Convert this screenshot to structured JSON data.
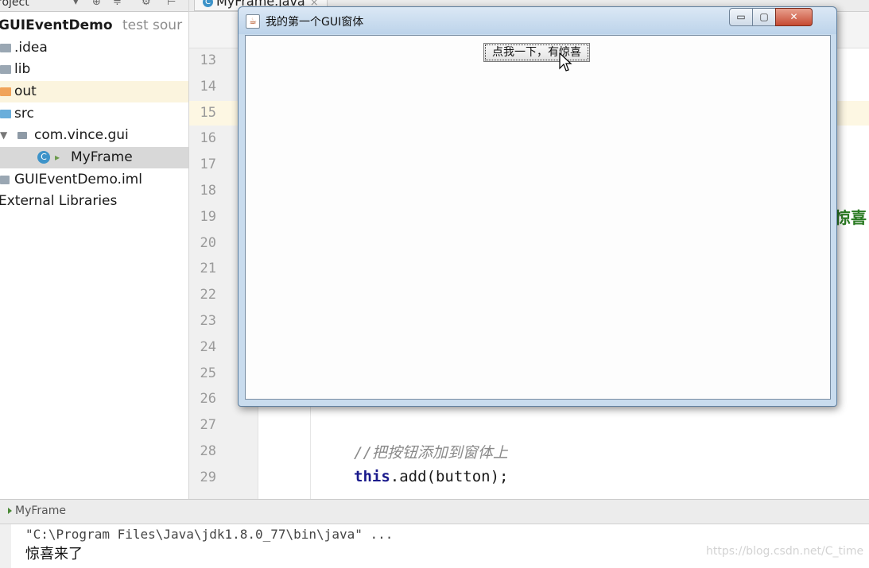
{
  "project": {
    "header_label": "roject",
    "root": {
      "name": "GUIEventDemo",
      "note": "test sour"
    },
    "items": [
      {
        "label": ".idea"
      },
      {
        "label": "lib"
      },
      {
        "label": "out"
      },
      {
        "label": "src"
      },
      {
        "label": "com.vince.gui"
      },
      {
        "label": "MyFrame"
      },
      {
        "label": "GUIEventDemo.iml"
      },
      {
        "label": "External Libraries"
      }
    ]
  },
  "editor": {
    "tab_label": "MyFrame.java",
    "line_numbers": [
      "13",
      "14",
      "15",
      "16",
      "17",
      "18",
      "19",
      "20",
      "21",
      "22",
      "23",
      "24",
      "25",
      "26",
      "27",
      "28",
      "29"
    ],
    "comment_line": "//把按钮添加到窗体上",
    "code_line": {
      "keyword": "this",
      "rest": ".add(button);"
    },
    "partial_string": "惊喜"
  },
  "gui_window": {
    "title": "我的第一个GUI窗体",
    "minimize": "▭",
    "maximize": "▢",
    "close": "✕",
    "button_label": "点我一下，有惊喜"
  },
  "run": {
    "title": "MyFrame",
    "command": "\"C:\\Program Files\\Java\\jdk1.8.0_77\\bin\\java\" ...",
    "output": "惊喜来了"
  },
  "watermark": "https://blog.csdn.net/C_time"
}
